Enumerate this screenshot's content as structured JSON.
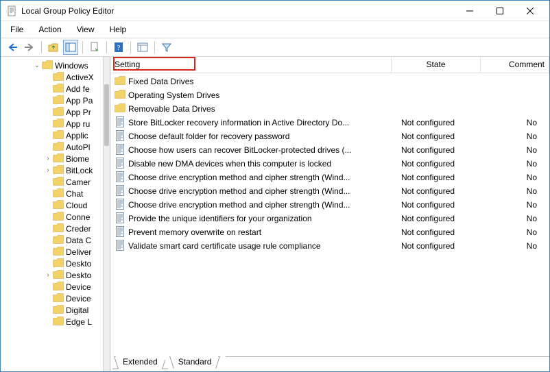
{
  "window": {
    "title": "Local Group Policy Editor"
  },
  "menu": {
    "file": "File",
    "action": "Action",
    "view": "View",
    "help": "Help"
  },
  "tree": {
    "root": {
      "label": "Windows",
      "expanded": true
    },
    "items": [
      {
        "label": "ActiveX",
        "expandable": false
      },
      {
        "label": "Add fe",
        "expandable": false
      },
      {
        "label": "App Pa",
        "expandable": false
      },
      {
        "label": "App Pr",
        "expandable": false
      },
      {
        "label": "App ru",
        "expandable": false
      },
      {
        "label": "Applic",
        "expandable": false
      },
      {
        "label": "AutoPl",
        "expandable": false
      },
      {
        "label": "Biome",
        "expandable": true
      },
      {
        "label": "BitLock",
        "expandable": true
      },
      {
        "label": "Camer",
        "expandable": false
      },
      {
        "label": "Chat",
        "expandable": false
      },
      {
        "label": "Cloud",
        "expandable": false
      },
      {
        "label": "Conne",
        "expandable": false
      },
      {
        "label": "Creder",
        "expandable": false
      },
      {
        "label": "Data C",
        "expandable": false
      },
      {
        "label": "Deliver",
        "expandable": false
      },
      {
        "label": "Deskto",
        "expandable": false
      },
      {
        "label": "Deskto",
        "expandable": true
      },
      {
        "label": "Device",
        "expandable": false
      },
      {
        "label": "Device",
        "expandable": false
      },
      {
        "label": "Digital",
        "expandable": false
      },
      {
        "label": "Edge L",
        "expandable": false
      }
    ]
  },
  "list": {
    "headers": {
      "setting": "Setting",
      "state": "State",
      "comment": "Comment"
    },
    "rows": [
      {
        "type": "folder",
        "setting": "Fixed Data Drives",
        "state": "",
        "comment": ""
      },
      {
        "type": "folder",
        "setting": "Operating System Drives",
        "state": "",
        "comment": ""
      },
      {
        "type": "folder",
        "setting": "Removable Data Drives",
        "state": "",
        "comment": ""
      },
      {
        "type": "policy",
        "setting": "Store BitLocker recovery information in Active Directory Do...",
        "state": "Not configured",
        "comment": "No"
      },
      {
        "type": "policy",
        "setting": "Choose default folder for recovery password",
        "state": "Not configured",
        "comment": "No"
      },
      {
        "type": "policy",
        "setting": "Choose how users can recover BitLocker-protected drives (...",
        "state": "Not configured",
        "comment": "No"
      },
      {
        "type": "policy",
        "setting": "Disable new DMA devices when this computer is locked",
        "state": "Not configured",
        "comment": "No"
      },
      {
        "type": "policy",
        "setting": "Choose drive encryption method and cipher strength (Wind...",
        "state": "Not configured",
        "comment": "No"
      },
      {
        "type": "policy",
        "setting": "Choose drive encryption method and cipher strength (Wind...",
        "state": "Not configured",
        "comment": "No"
      },
      {
        "type": "policy",
        "setting": "Choose drive encryption method and cipher strength (Wind...",
        "state": "Not configured",
        "comment": "No"
      },
      {
        "type": "policy",
        "setting": "Provide the unique identifiers for your organization",
        "state": "Not configured",
        "comment": "No"
      },
      {
        "type": "policy",
        "setting": "Prevent memory overwrite on restart",
        "state": "Not configured",
        "comment": "No"
      },
      {
        "type": "policy",
        "setting": "Validate smart card certificate usage rule compliance",
        "state": "Not configured",
        "comment": "No"
      }
    ]
  },
  "tabs": {
    "extended": "Extended",
    "standard": "Standard"
  }
}
